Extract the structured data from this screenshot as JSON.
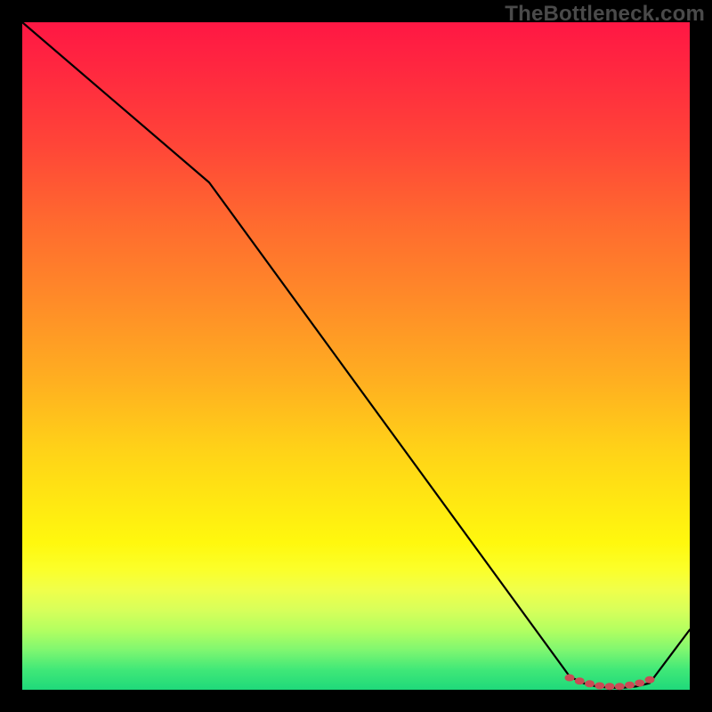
{
  "attribution": "TheBottleneck.com",
  "chart_data": {
    "type": "line",
    "title": "",
    "xlabel": "",
    "ylabel": "",
    "xlim": [
      0,
      100
    ],
    "ylim": [
      0,
      100
    ],
    "series": [
      {
        "name": "value-curve",
        "x": [
          0,
          28,
          82,
          84,
          86,
          88,
          90,
          92,
          94,
          100
        ],
        "values": [
          100,
          76,
          2,
          1,
          0.5,
          0.3,
          0.3,
          0.5,
          1,
          9
        ]
      }
    ],
    "markers": {
      "name": "emphasis-dots",
      "x": [
        82,
        83.5,
        85,
        86.5,
        88,
        89.5,
        91,
        92.5,
        94
      ],
      "values": [
        1.8,
        1.3,
        0.9,
        0.6,
        0.5,
        0.5,
        0.7,
        1.0,
        1.5
      ],
      "color": "#c94b55"
    },
    "gradient_stops": [
      {
        "pos": 0.0,
        "color": "#ff1744"
      },
      {
        "pos": 0.5,
        "color": "#ffb020"
      },
      {
        "pos": 0.8,
        "color": "#fff80e"
      },
      {
        "pos": 1.0,
        "color": "#1fd97a"
      }
    ]
  }
}
